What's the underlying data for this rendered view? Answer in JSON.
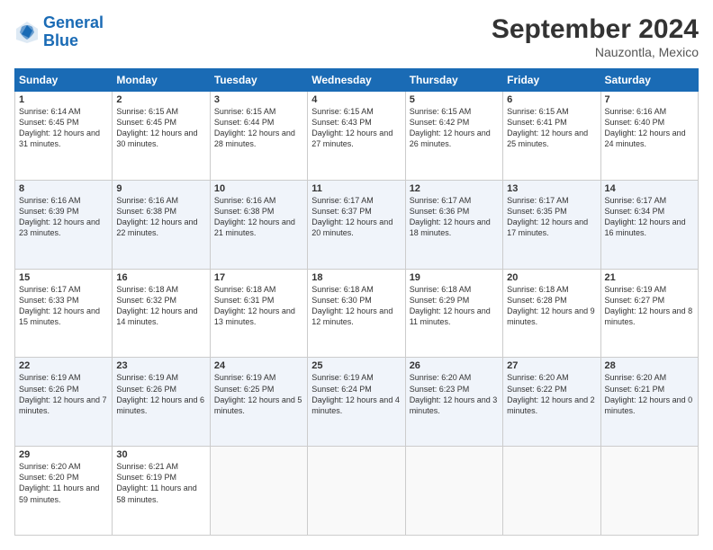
{
  "header": {
    "logo_line1": "General",
    "logo_line2": "Blue",
    "month_title": "September 2024",
    "location": "Nauzontla, Mexico"
  },
  "days_of_week": [
    "Sunday",
    "Monday",
    "Tuesday",
    "Wednesday",
    "Thursday",
    "Friday",
    "Saturday"
  ],
  "weeks": [
    [
      {
        "day": "1",
        "sunrise": "6:14 AM",
        "sunset": "6:45 PM",
        "daylight": "12 hours and 31 minutes."
      },
      {
        "day": "2",
        "sunrise": "6:15 AM",
        "sunset": "6:45 PM",
        "daylight": "12 hours and 30 minutes."
      },
      {
        "day": "3",
        "sunrise": "6:15 AM",
        "sunset": "6:44 PM",
        "daylight": "12 hours and 28 minutes."
      },
      {
        "day": "4",
        "sunrise": "6:15 AM",
        "sunset": "6:43 PM",
        "daylight": "12 hours and 27 minutes."
      },
      {
        "day": "5",
        "sunrise": "6:15 AM",
        "sunset": "6:42 PM",
        "daylight": "12 hours and 26 minutes."
      },
      {
        "day": "6",
        "sunrise": "6:15 AM",
        "sunset": "6:41 PM",
        "daylight": "12 hours and 25 minutes."
      },
      {
        "day": "7",
        "sunrise": "6:16 AM",
        "sunset": "6:40 PM",
        "daylight": "12 hours and 24 minutes."
      }
    ],
    [
      {
        "day": "8",
        "sunrise": "6:16 AM",
        "sunset": "6:39 PM",
        "daylight": "12 hours and 23 minutes."
      },
      {
        "day": "9",
        "sunrise": "6:16 AM",
        "sunset": "6:38 PM",
        "daylight": "12 hours and 22 minutes."
      },
      {
        "day": "10",
        "sunrise": "6:16 AM",
        "sunset": "6:38 PM",
        "daylight": "12 hours and 21 minutes."
      },
      {
        "day": "11",
        "sunrise": "6:17 AM",
        "sunset": "6:37 PM",
        "daylight": "12 hours and 20 minutes."
      },
      {
        "day": "12",
        "sunrise": "6:17 AM",
        "sunset": "6:36 PM",
        "daylight": "12 hours and 18 minutes."
      },
      {
        "day": "13",
        "sunrise": "6:17 AM",
        "sunset": "6:35 PM",
        "daylight": "12 hours and 17 minutes."
      },
      {
        "day": "14",
        "sunrise": "6:17 AM",
        "sunset": "6:34 PM",
        "daylight": "12 hours and 16 minutes."
      }
    ],
    [
      {
        "day": "15",
        "sunrise": "6:17 AM",
        "sunset": "6:33 PM",
        "daylight": "12 hours and 15 minutes."
      },
      {
        "day": "16",
        "sunrise": "6:18 AM",
        "sunset": "6:32 PM",
        "daylight": "12 hours and 14 minutes."
      },
      {
        "day": "17",
        "sunrise": "6:18 AM",
        "sunset": "6:31 PM",
        "daylight": "12 hours and 13 minutes."
      },
      {
        "day": "18",
        "sunrise": "6:18 AM",
        "sunset": "6:30 PM",
        "daylight": "12 hours and 12 minutes."
      },
      {
        "day": "19",
        "sunrise": "6:18 AM",
        "sunset": "6:29 PM",
        "daylight": "12 hours and 11 minutes."
      },
      {
        "day": "20",
        "sunrise": "6:18 AM",
        "sunset": "6:28 PM",
        "daylight": "12 hours and 9 minutes."
      },
      {
        "day": "21",
        "sunrise": "6:19 AM",
        "sunset": "6:27 PM",
        "daylight": "12 hours and 8 minutes."
      }
    ],
    [
      {
        "day": "22",
        "sunrise": "6:19 AM",
        "sunset": "6:26 PM",
        "daylight": "12 hours and 7 minutes."
      },
      {
        "day": "23",
        "sunrise": "6:19 AM",
        "sunset": "6:26 PM",
        "daylight": "12 hours and 6 minutes."
      },
      {
        "day": "24",
        "sunrise": "6:19 AM",
        "sunset": "6:25 PM",
        "daylight": "12 hours and 5 minutes."
      },
      {
        "day": "25",
        "sunrise": "6:19 AM",
        "sunset": "6:24 PM",
        "daylight": "12 hours and 4 minutes."
      },
      {
        "day": "26",
        "sunrise": "6:20 AM",
        "sunset": "6:23 PM",
        "daylight": "12 hours and 3 minutes."
      },
      {
        "day": "27",
        "sunrise": "6:20 AM",
        "sunset": "6:22 PM",
        "daylight": "12 hours and 2 minutes."
      },
      {
        "day": "28",
        "sunrise": "6:20 AM",
        "sunset": "6:21 PM",
        "daylight": "12 hours and 0 minutes."
      }
    ],
    [
      {
        "day": "29",
        "sunrise": "6:20 AM",
        "sunset": "6:20 PM",
        "daylight": "11 hours and 59 minutes."
      },
      {
        "day": "30",
        "sunrise": "6:21 AM",
        "sunset": "6:19 PM",
        "daylight": "11 hours and 58 minutes."
      },
      null,
      null,
      null,
      null,
      null
    ]
  ]
}
